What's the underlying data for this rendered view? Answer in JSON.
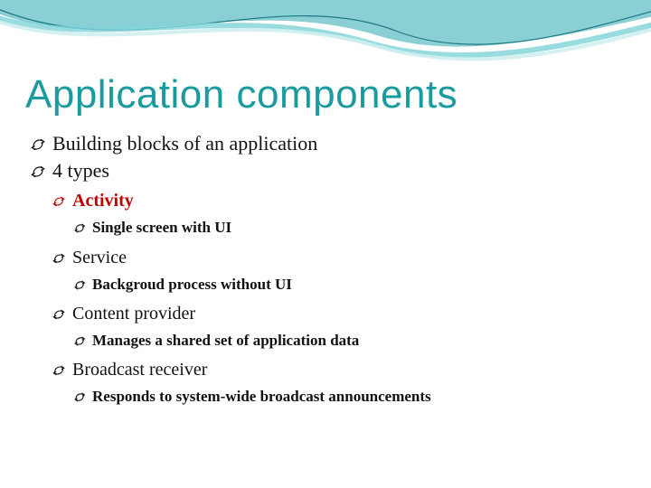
{
  "title": "Application components",
  "points": {
    "p1": "Building blocks of an application",
    "p2": "4 types",
    "types": {
      "t1": {
        "name": "Activity",
        "desc": "Single screen with UI"
      },
      "t2": {
        "name": "Service",
        "desc": "Backgroud process without UI"
      },
      "t3": {
        "name": "Content provider",
        "desc": "Manages a shared set of application data"
      },
      "t4": {
        "name": "Broadcast receiver",
        "desc": "Responds to system-wide broadcast announcements"
      }
    }
  }
}
